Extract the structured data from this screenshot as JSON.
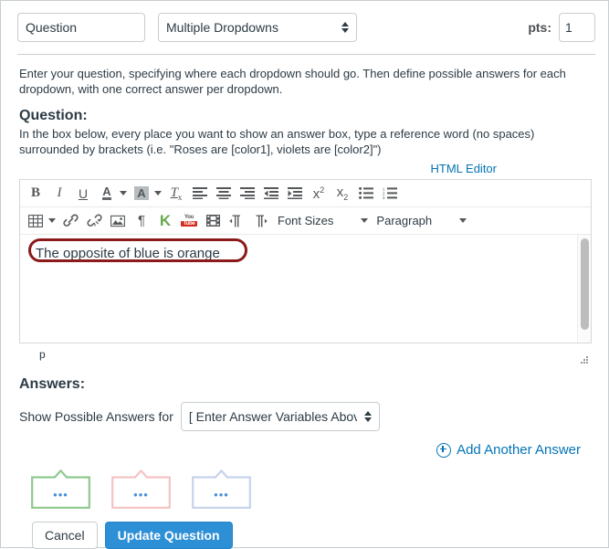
{
  "header": {
    "question_name_value": "Question",
    "question_name_placeholder": "Question",
    "question_type_value": "Multiple Dropdowns",
    "question_type_options": [
      "Multiple Dropdowns"
    ],
    "pts_label": "pts:",
    "pts_value": "1"
  },
  "instructions": {
    "intro": "Enter your question, specifying where each dropdown should go. Then define possible answers for each dropdown, with one correct answer per dropdown.",
    "question_heading": "Question:",
    "question_sub": "In the box below, every place you want to show an answer box, type a reference word (no spaces) surrounded by brackets (i.e. \"Roses are [color1], violets are [color2]\")"
  },
  "editor": {
    "html_editor_link": "HTML Editor",
    "content_text": "The opposite of blue is orange",
    "status_path": "p",
    "toolbar_row1": [
      {
        "name": "bold-icon",
        "label": "B"
      },
      {
        "name": "italic-icon",
        "label": "I"
      },
      {
        "name": "underline-icon",
        "label": "U"
      },
      {
        "name": "text-color-icon",
        "label": "A"
      },
      {
        "name": "background-color-icon",
        "label": "A"
      },
      {
        "name": "remove-formatting-icon",
        "label": "Tx"
      },
      {
        "name": "align-left-icon",
        "label": "align left"
      },
      {
        "name": "align-center-icon",
        "label": "align center"
      },
      {
        "name": "align-right-icon",
        "label": "align right"
      },
      {
        "name": "outdent-icon",
        "label": "outdent"
      },
      {
        "name": "indent-icon",
        "label": "indent"
      },
      {
        "name": "superscript-icon",
        "label": "x2"
      },
      {
        "name": "subscript-icon",
        "label": "x2"
      },
      {
        "name": "bulleted-list-icon",
        "label": "bulleted list"
      },
      {
        "name": "numbered-list-icon",
        "label": "numbered list"
      }
    ],
    "toolbar_row2": [
      {
        "name": "table-icon",
        "label": "table"
      },
      {
        "name": "link-icon",
        "label": "link"
      },
      {
        "name": "unlink-icon",
        "label": "unlink"
      },
      {
        "name": "image-icon",
        "label": "image"
      },
      {
        "name": "pilcrow-icon",
        "label": "paragraph mark"
      },
      {
        "name": "kaltura-icon",
        "label": "K"
      },
      {
        "name": "youtube-icon",
        "label_top": "You",
        "label_bottom": "Tube"
      },
      {
        "name": "media-icon",
        "label": "media"
      },
      {
        "name": "ltr-icon",
        "label": "left to right"
      },
      {
        "name": "rtl-icon",
        "label": "right to left"
      }
    ],
    "font_sizes_label": "Font Sizes",
    "paragraph_label": "Paragraph"
  },
  "answers": {
    "heading": "Answers:",
    "show_answers_label": "Show Possible Answers for",
    "variable_select_value": "[ Enter Answer Variables Above ]",
    "variable_select_options": [
      "[ Enter Answer Variables Above ]"
    ],
    "add_another_answer": "Add Another Answer",
    "boxes": [
      {
        "name": "answer-box-green",
        "color": "#8fc98f",
        "dots": "•••"
      },
      {
        "name": "answer-box-red",
        "color": "#f4c3c3",
        "dots": "•••"
      },
      {
        "name": "answer-box-blue",
        "color": "#c6d3ea",
        "dots": "•••"
      }
    ]
  },
  "footer": {
    "cancel_label": "Cancel",
    "update_label": "Update Question"
  },
  "colors": {
    "link": "#0374b5",
    "primary_button": "#2d8fd5",
    "annotation": "#8b1a1a"
  }
}
